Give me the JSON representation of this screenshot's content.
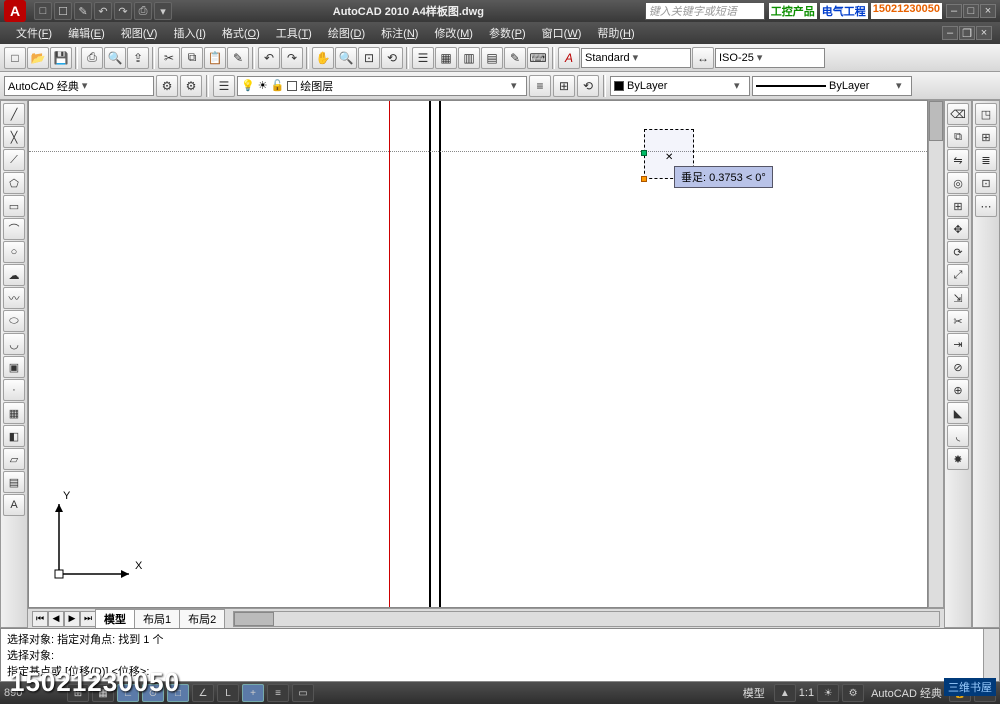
{
  "title": "AutoCAD 2010   A4样板图.dwg",
  "search_placeholder": "键入关键字或短语",
  "promo": {
    "p1": "工控产品",
    "p2": "电气工程",
    "p3": "15021230050"
  },
  "menus": [
    {
      "t": "文件",
      "k": "F"
    },
    {
      "t": "编辑",
      "k": "E"
    },
    {
      "t": "视图",
      "k": "V"
    },
    {
      "t": "插入",
      "k": "I"
    },
    {
      "t": "格式",
      "k": "O"
    },
    {
      "t": "工具",
      "k": "T"
    },
    {
      "t": "绘图",
      "k": "D"
    },
    {
      "t": "标注",
      "k": "N"
    },
    {
      "t": "修改",
      "k": "M"
    },
    {
      "t": "参数",
      "k": "P"
    },
    {
      "t": "窗口",
      "k": "W"
    },
    {
      "t": "帮助",
      "k": "H"
    }
  ],
  "workspace_combo": "AutoCAD 经典",
  "layer_name": "绘图层",
  "textstyle": "Standard",
  "dimstyle": "ISO-25",
  "bylayer": "ByLayer",
  "tooltip": "垂足: 0.3753 < 0°",
  "ucs": {
    "x": "X",
    "y": "Y"
  },
  "tabs": {
    "model": "模型",
    "l1": "布局1",
    "l2": "布局2"
  },
  "cmd": {
    "l1": "选择对象: 指定对角点: 找到 1 个",
    "l2": "选择对象:",
    "l3": "指定基点或 [位移(D)] <位移>:"
  },
  "status": {
    "coord": "890",
    "scale": "1:1",
    "anno": "模型",
    "ws": "AutoCAD 经典"
  },
  "watermark": "15021230050",
  "corner": "三维书屋"
}
